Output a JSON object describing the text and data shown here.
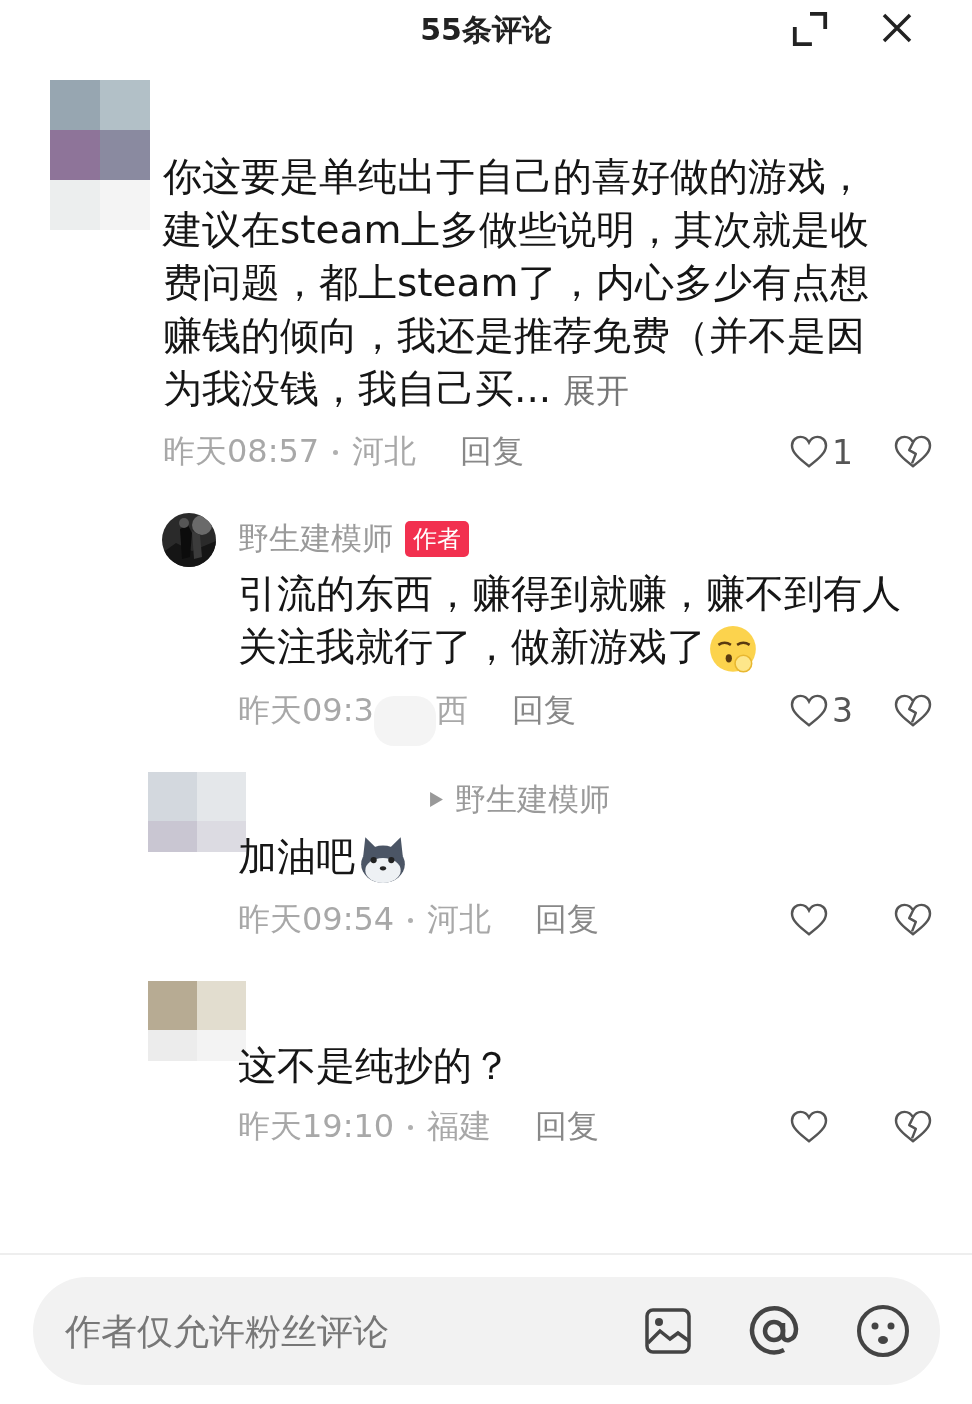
{
  "header": {
    "title": "55条评论"
  },
  "comments": [
    {
      "kind": "top",
      "text": "你这要是单纯出于自己的喜好做的游戏，建议在steam上多做些说明，其次就是收费问题，都上steam了，内心多少有点想赚钱的倾向，我还是推荐免费（并不是因为我没钱，我自己买...",
      "expand": "展开",
      "time": "昨天08:57",
      "location": "河北",
      "reply_label": "回复",
      "likes": "1",
      "meta_covered": false
    },
    {
      "kind": "author_reply",
      "author": "野生建模师",
      "badge": "作者",
      "text": "引流的东西，赚得到就赚，赚不到有人关注我就行了，做新游戏了",
      "emoji": {
        "kind": "face"
      },
      "time": "昨天09:3",
      "location": "西",
      "reply_label": "回复",
      "likes": "3",
      "meta_covered": true
    },
    {
      "kind": "reply",
      "reply_to": "野生建模师",
      "text": "加油吧",
      "emoji": {
        "kind": "dog"
      },
      "time": "昨天09:54",
      "location": "河北",
      "reply_label": "回复",
      "meta_covered": false
    },
    {
      "kind": "reply",
      "text": "这不是纯抄的？",
      "time": "昨天19:10",
      "location": "福建",
      "reply_label": "回复",
      "meta_covered": false
    }
  ],
  "composer": {
    "placeholder": "作者仅允许粉丝评论"
  }
}
